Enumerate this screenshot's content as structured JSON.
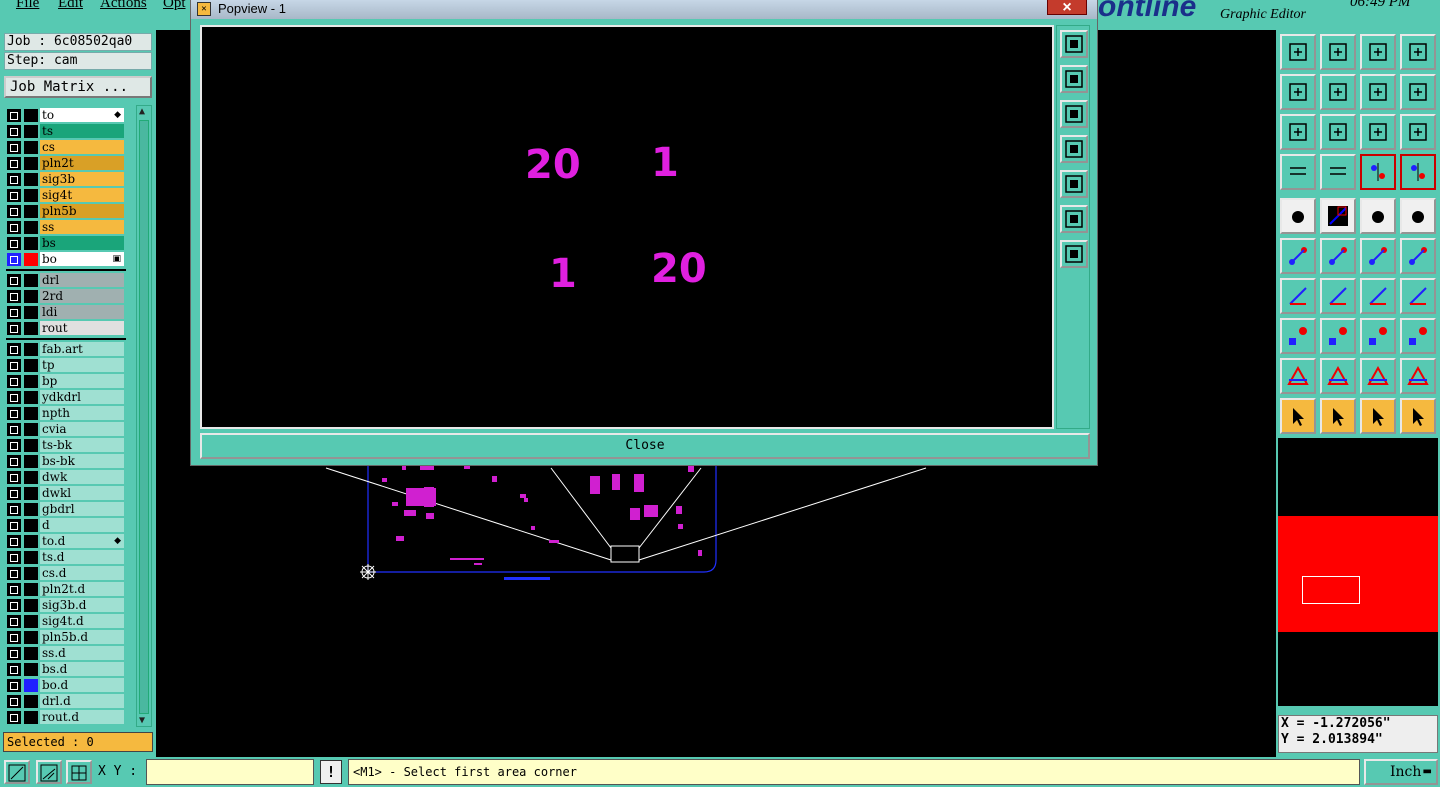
{
  "menu": [
    "File",
    "Edit",
    "Actions",
    "Opt"
  ],
  "brand": "ontline",
  "subtitle": "Graphic Editor",
  "clock": "06:49 PM",
  "job_label": "Job : 6c08502qa0",
  "step_label": "Step: cam",
  "job_matrix_label": "Job Matrix ...",
  "layers_board": [
    {
      "name": "to",
      "color": "#ffffff",
      "flag": "◆"
    },
    {
      "name": "ts",
      "color": "#1aa57a"
    },
    {
      "name": "cs",
      "color": "#f5b93f"
    },
    {
      "name": "pln2t",
      "color": "#d9a026"
    },
    {
      "name": "sig3b",
      "color": "#f5b93f"
    },
    {
      "name": "sig4t",
      "color": "#f5b93f"
    },
    {
      "name": "pln5b",
      "color": "#d9a026"
    },
    {
      "name": "ss",
      "color": "#f5b93f"
    },
    {
      "name": "bs",
      "color": "#1aa57a"
    },
    {
      "name": "bo",
      "color": "#ffffff",
      "flag": "▣",
      "active": true
    }
  ],
  "layers_drill": [
    {
      "name": "drl",
      "color": "#a0b0b0"
    },
    {
      "name": "2rd",
      "color": "#a0b0b0"
    },
    {
      "name": "ldi",
      "color": "#a0b0b0"
    },
    {
      "name": "rout",
      "color": "#e0e0e0"
    }
  ],
  "layers_misc": [
    {
      "name": "fab.art"
    },
    {
      "name": "tp"
    },
    {
      "name": "bp"
    },
    {
      "name": "ydkdrl"
    },
    {
      "name": "npth"
    },
    {
      "name": "cvia"
    },
    {
      "name": "ts-bk"
    },
    {
      "name": "bs-bk"
    },
    {
      "name": "dwk"
    },
    {
      "name": "dwkl"
    },
    {
      "name": "gbdrl"
    },
    {
      "name": "d"
    },
    {
      "name": "to.d",
      "flag": "◆"
    },
    {
      "name": "ts.d"
    },
    {
      "name": "cs.d"
    },
    {
      "name": "pln2t.d"
    },
    {
      "name": "sig3b.d"
    },
    {
      "name": "sig4t.d"
    },
    {
      "name": "pln5b.d"
    },
    {
      "name": "ss.d"
    },
    {
      "name": "bs.d"
    },
    {
      "name": "bo.d",
      "swatch": "#2020ff"
    },
    {
      "name": "drl.d"
    },
    {
      "name": "rout.d"
    }
  ],
  "selected_label": "Selected : 0",
  "popview": {
    "title": "Popview - 1",
    "close_x": "×",
    "close_button": "Close",
    "numbers": [
      "20",
      "1",
      "1",
      "20"
    ]
  },
  "coords": {
    "x": "X = -1.272056\"",
    "y": "Y = 2.013894\""
  },
  "bottom": {
    "xy_label": "X Y :",
    "xy_value": "",
    "warn": "!",
    "prompt": "<M1> - Select first area corner",
    "units": "Inch",
    "units_chevron": "▬"
  },
  "colors": {
    "panel": "#57c9b2",
    "highlight": "#f5b93f",
    "feature": "#e020e0",
    "outline": "#2020ff"
  }
}
